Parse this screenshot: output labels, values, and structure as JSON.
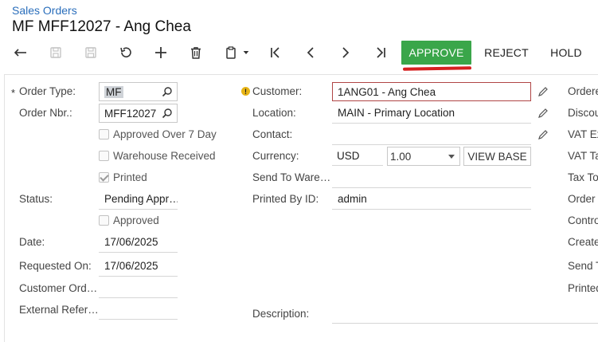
{
  "breadcrumb": "Sales Orders",
  "title": "MF MFF12027 - Ang Chea",
  "toolbar": {
    "approve": "APPROVE",
    "reject": "REJECT",
    "hold": "HOLD"
  },
  "icons": {
    "undo": "undo-icon",
    "save_close": "save-close-icon",
    "save": "save-icon",
    "cancel": "revert-icon",
    "add": "plus-icon",
    "delete": "trash-icon",
    "copy": "clipboard-icon",
    "first": "first-page-icon",
    "prev": "chevron-left-icon",
    "next": "chevron-right-icon",
    "last": "last-page-icon"
  },
  "colors": {
    "approve_bg": "#3aa64a",
    "link": "#2a6ebb",
    "error_border": "#b04545",
    "warning": "#e7b416"
  },
  "left": {
    "order_type_label": "Order Type:",
    "order_type_value": "MF",
    "order_nbr_label": "Order Nbr.:",
    "order_nbr_value": "MFF12027",
    "approved_over_7": "Approved Over 7 Day",
    "warehouse_received": "Warehouse Received",
    "printed": "Printed",
    "status_label": "Status:",
    "status_value": "Pending Appr…",
    "approved": "Approved",
    "date_label": "Date:",
    "date_value": "17/06/2025",
    "requested_label": "Requested On:",
    "requested_value": "17/06/2025",
    "customer_ord_label": "Customer Ord…",
    "external_ref_label": "External Refer…"
  },
  "middle": {
    "customer_label": "Customer:",
    "customer_value": "1ANG01 - Ang Chea",
    "location_label": "Location:",
    "location_value": "MAIN - Primary Location",
    "contact_label": "Contact:",
    "currency_label": "Currency:",
    "currency_value": "USD",
    "rate_value": "1.00",
    "view_base": "VIEW BASE",
    "send_to_ware_label": "Send To Ware…",
    "printed_by_label": "Printed By ID:",
    "printed_by_value": "admin",
    "description_label": "Description:"
  },
  "right": {
    "labels": [
      "Ordere",
      "Discou",
      "VAT Ex",
      "VAT Ta",
      "Tax To",
      "Order T",
      "Contro",
      "Create",
      "Send T",
      "Printed"
    ]
  }
}
